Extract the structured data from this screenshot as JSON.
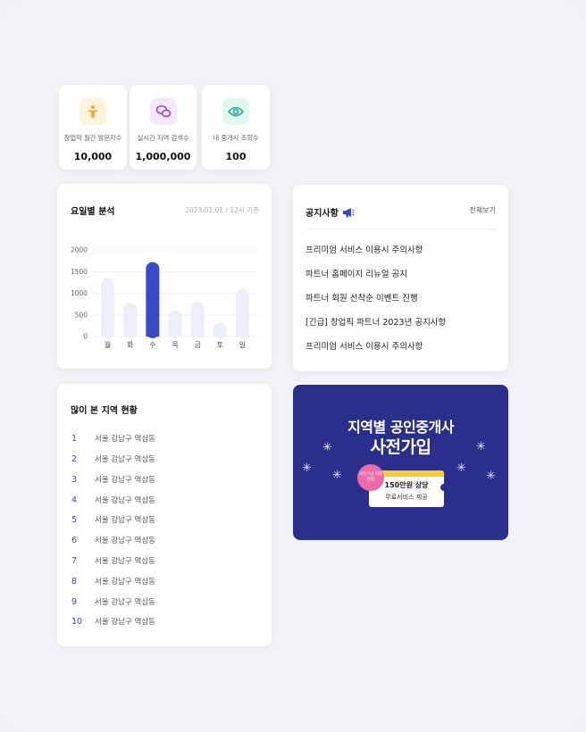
{
  "stats": [
    {
      "label": "창업픽 월간 방문자수",
      "value": "10,000",
      "icon": "person-icon",
      "bg": "#fff3e0",
      "fg": "#f5a623"
    },
    {
      "label": "실시간 지역 검색수",
      "value": "1,000,000",
      "icon": "chat-bubbles-icon",
      "bg": "#f3e8fd",
      "fg": "#8e44d6"
    },
    {
      "label": "내 중개사 조회수",
      "value": "100",
      "icon": "eye-icon",
      "bg": "#e0f7f2",
      "fg": "#1fae8c"
    }
  ],
  "weekday_chart": {
    "title": "요일별 분석",
    "subtitle": "2023.01.01 / 12시 기준"
  },
  "chart_data": {
    "type": "bar",
    "categories": [
      "월",
      "화",
      "수",
      "목",
      "금",
      "토",
      "일"
    ],
    "values": [
      1350,
      780,
      1720,
      600,
      790,
      320,
      1100
    ],
    "highlight_index": 2,
    "ylim": [
      0,
      2000
    ],
    "yticks": [
      0,
      500,
      1000,
      1500,
      2000
    ],
    "grid": true,
    "bar_color": "#eceefc",
    "highlight_color": "#3b4bc8"
  },
  "notice": {
    "title": "공지사항",
    "more_label": "전체보기",
    "items": [
      "프리미엄 서비스 이용시 주의사항",
      "파트너 홈페이지 리뉴얼 공지",
      "파트너 회원 선착순 이벤트 진행",
      "[긴급] 창업픽 파트너 2023년 공지사항",
      "프리미엄 서비스 이용시 주의사항"
    ]
  },
  "regions": {
    "title": "많이 본 지역 현황",
    "items": [
      {
        "rank": "1",
        "name": "서울 강남구 역삼동"
      },
      {
        "rank": "2",
        "name": "서울 강남구 역삼동"
      },
      {
        "rank": "3",
        "name": "서울 강남구 역삼동"
      },
      {
        "rank": "4",
        "name": "서울 강남구 역삼동"
      },
      {
        "rank": "5",
        "name": "서울 강남구 역삼동"
      },
      {
        "rank": "6",
        "name": "서울 강남구 역삼동"
      },
      {
        "rank": "7",
        "name": "서울 강남구 역삼동"
      },
      {
        "rank": "8",
        "name": "서울 강남구 역삼동"
      },
      {
        "rank": "9",
        "name": "서울 강남구 역삼동"
      },
      {
        "rank": "10",
        "name": "서울 강남구 역삼동"
      }
    ]
  },
  "banner": {
    "line1": "지역별 공인중개사",
    "line2": "사전가입",
    "badge": "사전가입 회원한정",
    "coupon_line1": "150만원 상당",
    "coupon_line2": "무료서비스 제공",
    "bg": "#2a2f8c"
  }
}
